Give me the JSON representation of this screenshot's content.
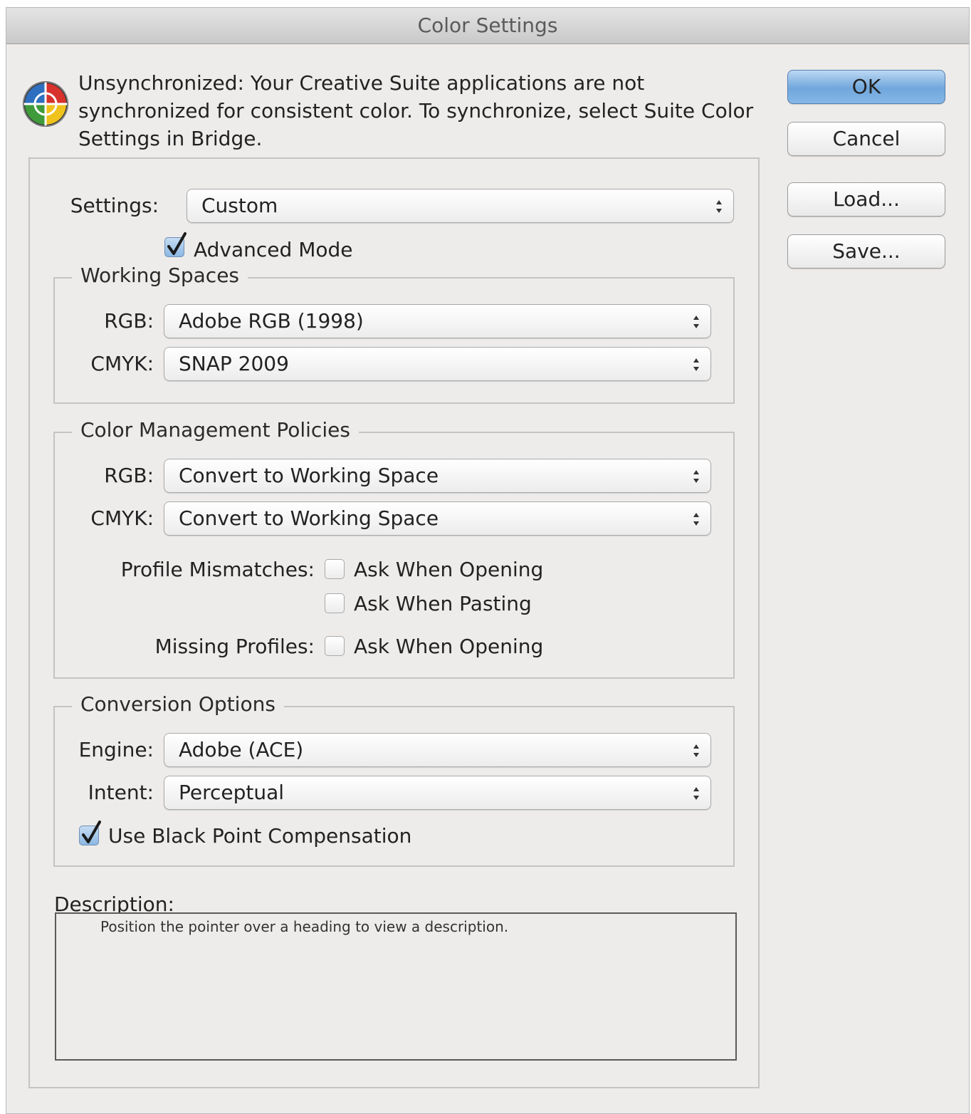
{
  "window": {
    "title": "Color Settings"
  },
  "sync": {
    "icon": "color-sync-icon",
    "message": "Unsynchronized: Your Creative Suite applications are not synchronized for consistent color. To synchronize, select Suite Color Settings in Bridge."
  },
  "buttons": {
    "ok": "OK",
    "cancel": "Cancel",
    "load": "Load...",
    "save": "Save..."
  },
  "settings": {
    "label": "Settings:",
    "value": "Custom",
    "advanced_mode_label": "Advanced Mode",
    "advanced_mode_checked": true
  },
  "working_spaces": {
    "title": "Working Spaces",
    "rgb_label": "RGB:",
    "rgb_value": "Adobe RGB (1998)",
    "cmyk_label": "CMYK:",
    "cmyk_value": "SNAP 2009"
  },
  "policies": {
    "title": "Color Management Policies",
    "rgb_label": "RGB:",
    "rgb_value": "Convert to Working Space",
    "cmyk_label": "CMYK:",
    "cmyk_value": "Convert to Working Space",
    "profile_mismatches_label": "Profile Mismatches:",
    "mismatch_opening_label": "Ask When Opening",
    "mismatch_opening_checked": false,
    "mismatch_pasting_label": "Ask When Pasting",
    "mismatch_pasting_checked": false,
    "missing_profiles_label": "Missing Profiles:",
    "missing_opening_label": "Ask When Opening",
    "missing_opening_checked": false
  },
  "conversion": {
    "title": "Conversion Options",
    "engine_label": "Engine:",
    "engine_value": "Adobe (ACE)",
    "intent_label": "Intent:",
    "intent_value": "Perceptual",
    "bpc_label": "Use Black Point Compensation",
    "bpc_checked": true
  },
  "description": {
    "label": "Description:",
    "text": "Position the pointer over a heading to view a description."
  },
  "colors": {
    "dialog_bg": "#eeeceb",
    "default_button": "#6fa6dc",
    "group_border": "#c4c4c4"
  }
}
